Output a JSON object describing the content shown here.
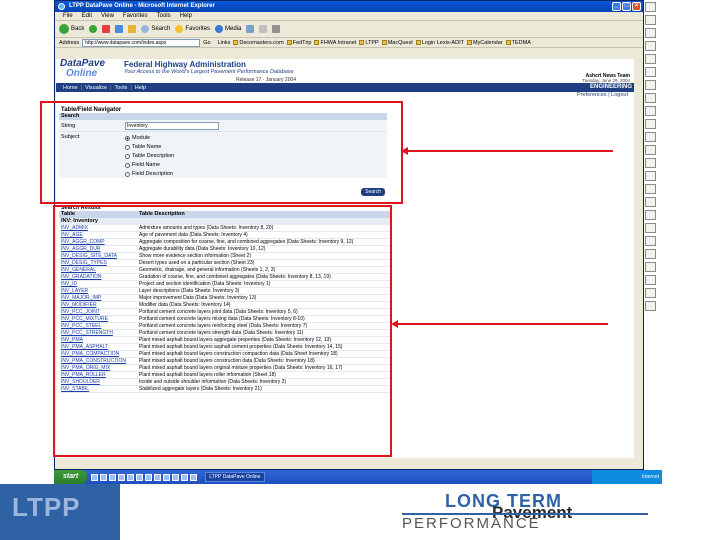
{
  "browser": {
    "title": "LTPP DataPave Online - Microsoft Internet Explorer",
    "menu": [
      "File",
      "Edit",
      "View",
      "Favorites",
      "Tools",
      "Help"
    ],
    "toolbar": [
      "Back",
      "Search",
      "Favorites",
      "Media"
    ],
    "address_label": "Address",
    "address_value": "http://www.datapave.com/index.aspx",
    "go_label": "Go",
    "links_label": "Links",
    "links": [
      "Decomasters.com",
      "FedTrip",
      "FHWA Intranet",
      "LTPP",
      "MacQuest",
      "Login Lexis-ADIT",
      "MyCalendar",
      "TEDMA"
    ]
  },
  "site": {
    "logo_line1": "DataPave",
    "logo_line2": "Online",
    "agency": "Federal Highway Administration",
    "tagline": "Your Access to the World's Largest Pavement Performance Database",
    "release": "Release 17 · January 2004",
    "top_right": "Ashcrt News Team",
    "date": "Tuesday, June 29, 2004",
    "nav": [
      "Home",
      "Visualize",
      "Tools",
      "Help"
    ],
    "section_badge": "ENGINEERING",
    "user_links": "Preferences | Logout"
  },
  "navigator": {
    "title": "Table/Field Navigator",
    "search_header": "Search",
    "string_label": "String",
    "string_value": "Inventory",
    "subject_label": "Subject",
    "options": [
      {
        "label": "Module",
        "selected": true
      },
      {
        "label": "Table Name",
        "selected": false
      },
      {
        "label": "Table Description",
        "selected": false
      },
      {
        "label": "Field Name",
        "selected": false
      },
      {
        "label": "Field Description",
        "selected": false
      }
    ],
    "search_button": "Search"
  },
  "results": {
    "title": "Search Results",
    "col_table": "Table",
    "col_desc": "Table Description",
    "group": "INV: Inventory",
    "rows": [
      {
        "name": "INV_ADMIX",
        "desc": "Admixture amounts and types (Data Sheets: Inventory 8, 20)"
      },
      {
        "name": "INV_AGE",
        "desc": "Age of pavement data (Data Sheets: Inventory 4)"
      },
      {
        "name": "INV_AGGR_COMP",
        "desc": "Aggregate composition for coarse, fine, and combined aggregates (Data Sheets: Inventory 9, 12)"
      },
      {
        "name": "INV_AGGR_DUR",
        "desc": "Aggregate durability data (Data Sheets: Inventory 10, 12)"
      },
      {
        "name": "INV_DESIG_SITE_DATA",
        "desc": "Show more evidence section information (Sheet 2)"
      },
      {
        "name": "INV_DESIG_TYPES",
        "desc": "Desert types used on a particular section (Sheet 23)"
      },
      {
        "name": "INV_GENERAL",
        "desc": "Geometric, drainage, and general information (Sheets 1, 2, 3)"
      },
      {
        "name": "INV_GRADATION",
        "desc": "Gradation of coarse, fine, and combined aggregates (Data Sheets: Inventory 8, 13, 19)"
      },
      {
        "name": "INV_ID",
        "desc": "Project and section identification (Data Sheets: Inventory 1)"
      },
      {
        "name": "INV_LAYER",
        "desc": "Layer descriptions (Data Sheets: Inventory 3)"
      },
      {
        "name": "INV_MAJOR_IMP",
        "desc": "Major improvement Data (Data Sheets: Inventory 13)"
      },
      {
        "name": "INV_MODIFIER",
        "desc": "Modifier data (Data Sheets: Inventory 14)"
      },
      {
        "name": "INV_PCC_JOINT",
        "desc": "Portland cement concrete layers joint data (Data Sheets: Inventory 5, 6)"
      },
      {
        "name": "INV_PCC_MIXTURE",
        "desc": "Portland cement concrete layers mixing data (Data Sheets: Inventory 8-10)"
      },
      {
        "name": "INV_PCC_STEEL",
        "desc": "Portland cement concrete layers reinforcing steel (Data Sheets: Inventory 7)"
      },
      {
        "name": "INV_PCC_STRENGTH",
        "desc": "Portland cement concrete layers strength data (Data Sheets: Inventory 11)"
      },
      {
        "name": "INV_PMA",
        "desc": "Plant mixed asphalt bound layers aggregate properties (Data Sheets: Inventory 12, 13)"
      },
      {
        "name": "INV_PMA_ASPHALT",
        "desc": "Plant mixed asphalt bound layers asphalt cement properties (Data Sheets: Inventory 14, 15)"
      },
      {
        "name": "INV_PMA_COMPACTION",
        "desc": "Plant mixed asphalt bound layers construction compaction data (Data Sheet Inventory 18)"
      },
      {
        "name": "INV_PMA_CONSTRUCTION",
        "desc": "Plant mixed asphalt bound layers construction data (Data Sheets: Inventory 18)"
      },
      {
        "name": "INV_PMA_ORIG_MIX",
        "desc": "Plant mixed asphalt bound layers original mixture properties (Data Sheets: Inventory 16, 17)"
      },
      {
        "name": "INV_PMA_ROLLER",
        "desc": "Plant mixed asphalt bound layers roller information (Sheet 18)"
      },
      {
        "name": "INV_SHOULDER",
        "desc": "Inside and outside shoulder information (Data Sheets: Inventory 2)"
      },
      {
        "name": "INV_STABIL",
        "desc": "Stabilized aggregate layers (Data Sheets: Inventory 21)"
      }
    ]
  },
  "taskbar": {
    "start": "start",
    "window": "LTPP DataPave Online",
    "tray": "Internet"
  },
  "branding": {
    "ltpp": "LTPP",
    "long_term": "LONG TERM",
    "pavement": "Pavement",
    "performance": "PERFORMANCE"
  },
  "colors": {
    "accent": "#1f3f82",
    "annotation": "#e0141e",
    "brand_blue": "#2e62a4"
  }
}
